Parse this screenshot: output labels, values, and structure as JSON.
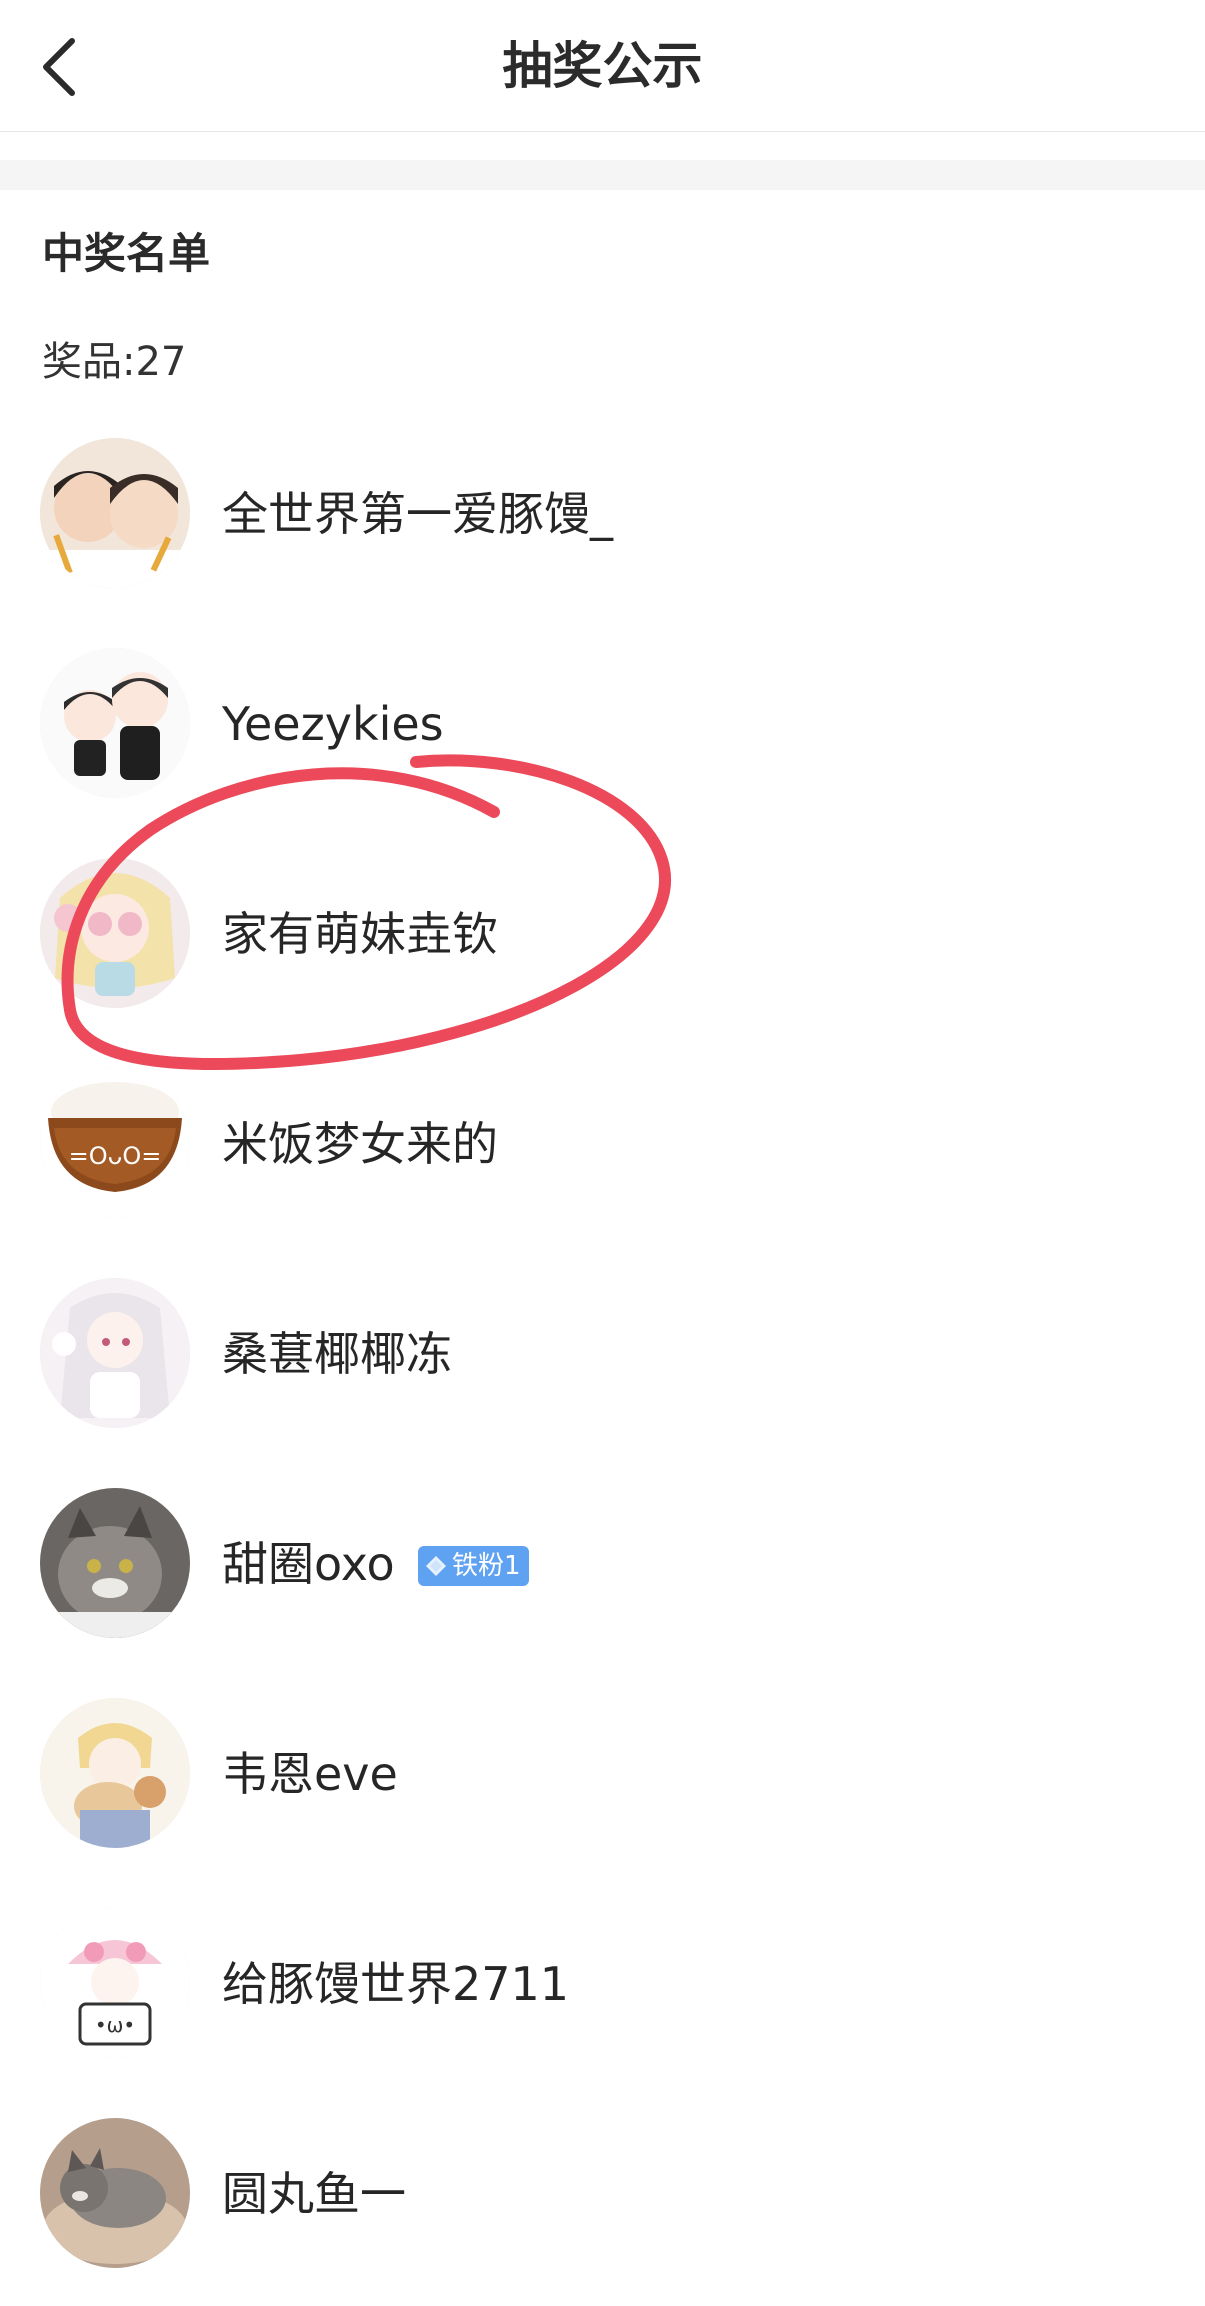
{
  "header": {
    "title": "抽奖公示",
    "back_icon": "chevron-left-icon"
  },
  "section": {
    "title": "中奖名单",
    "prize_label": "奖品:27"
  },
  "winners": [
    {
      "name": "全世界第一爱豚馒_",
      "avatar": "avatar-two-kids"
    },
    {
      "name": "Yeezykies",
      "avatar": "avatar-cartoon-boys"
    },
    {
      "name": "家有萌妹垚钦",
      "avatar": "avatar-anime-girl-blonde"
    },
    {
      "name": "米饭梦女来的",
      "avatar": "avatar-rice-bowl"
    },
    {
      "name": "桑葚椰椰冻",
      "avatar": "avatar-anime-girl-white-hair"
    },
    {
      "name": "甜圈oxo",
      "avatar": "avatar-cat",
      "badge": "铁粉1"
    },
    {
      "name": "韦恩eve",
      "avatar": "avatar-anime-boy-cat"
    },
    {
      "name": "给豚馒世界2711",
      "avatar": "avatar-pink-hat-girl"
    },
    {
      "name": "圆丸鱼一",
      "avatar": "avatar-cat-lying"
    }
  ],
  "colors": {
    "badge_blue": "#5fa2f1",
    "annotation_red": "#ec4a5a"
  }
}
